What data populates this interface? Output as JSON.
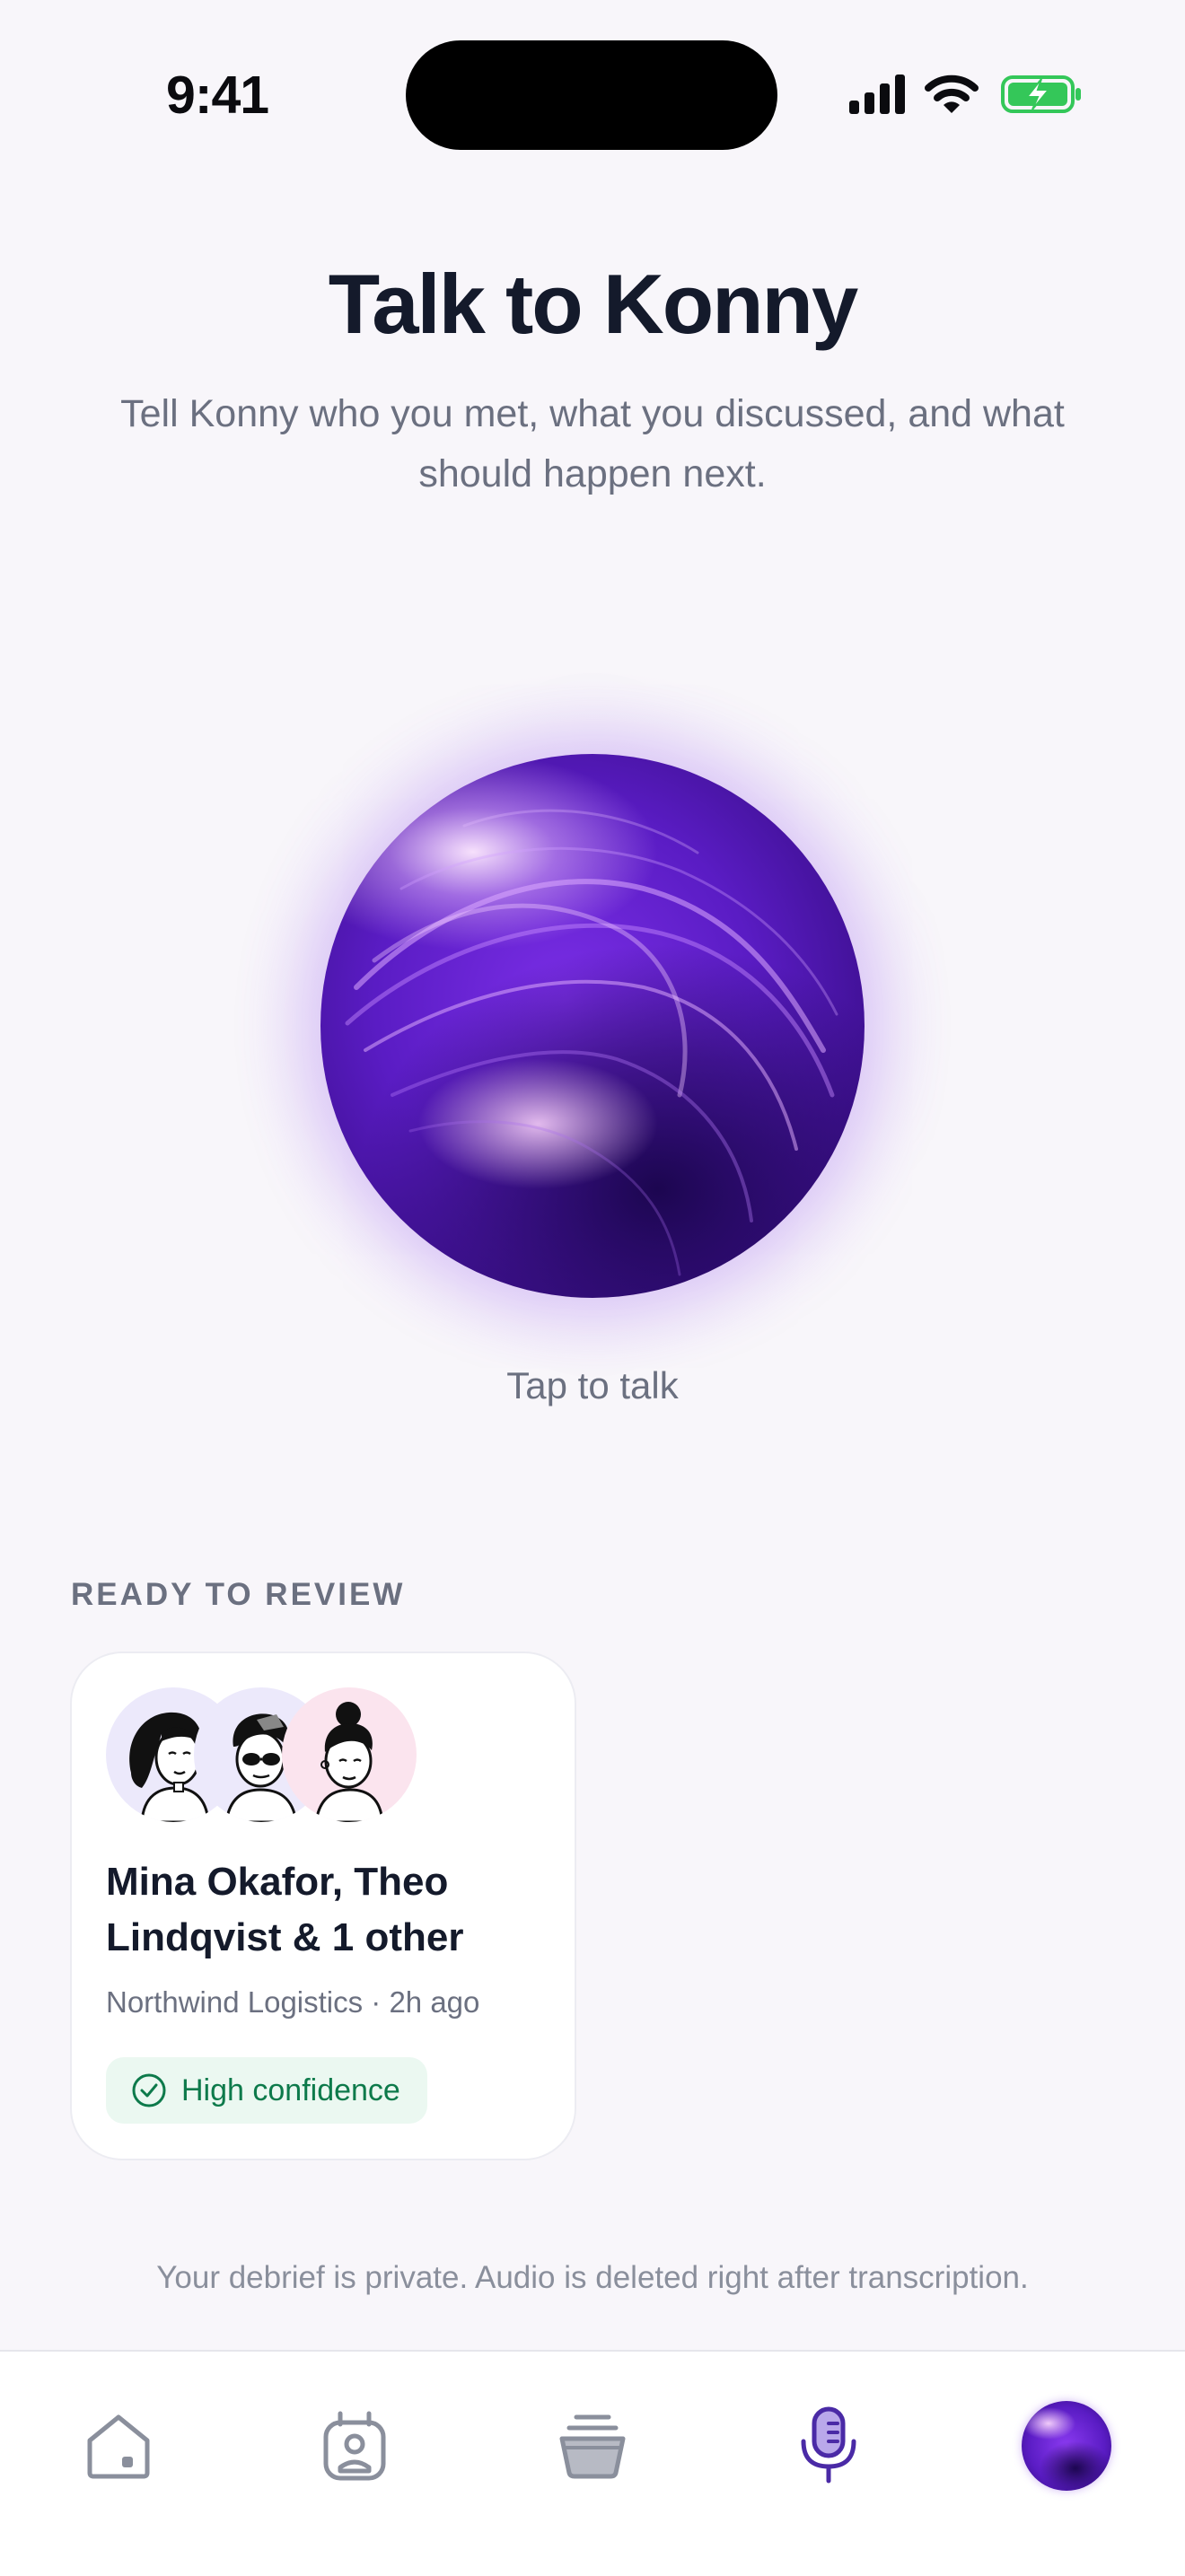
{
  "status_bar": {
    "time": "9:41"
  },
  "header": {
    "title": "Talk to Konny",
    "subtitle": "Tell Konny who you met, what you discussed, and what should happen next."
  },
  "orb": {
    "caption": "Tap to talk"
  },
  "review_section": {
    "label": "READY TO REVIEW",
    "card": {
      "names": "Mina Okafor, Theo Lindqvist & 1 other",
      "meta": "Northwind Logistics · 2h ago",
      "badge": "High confidence"
    }
  },
  "privacy_note": "Your debrief is private. Audio is deleted right after transcription.",
  "tab_bar": {
    "tabs": [
      "home-icon",
      "contacts-badge-icon",
      "inbox-stack-icon",
      "microphone-icon",
      "profile-orb-avatar"
    ],
    "active_index": 3
  },
  "colors": {
    "accent": "#5b2fc9",
    "title": "#141a2b",
    "muted": "#6b7080",
    "badge_bg": "#ebf8f1",
    "badge_text": "#0d7a4b",
    "battery": "#34c759"
  }
}
